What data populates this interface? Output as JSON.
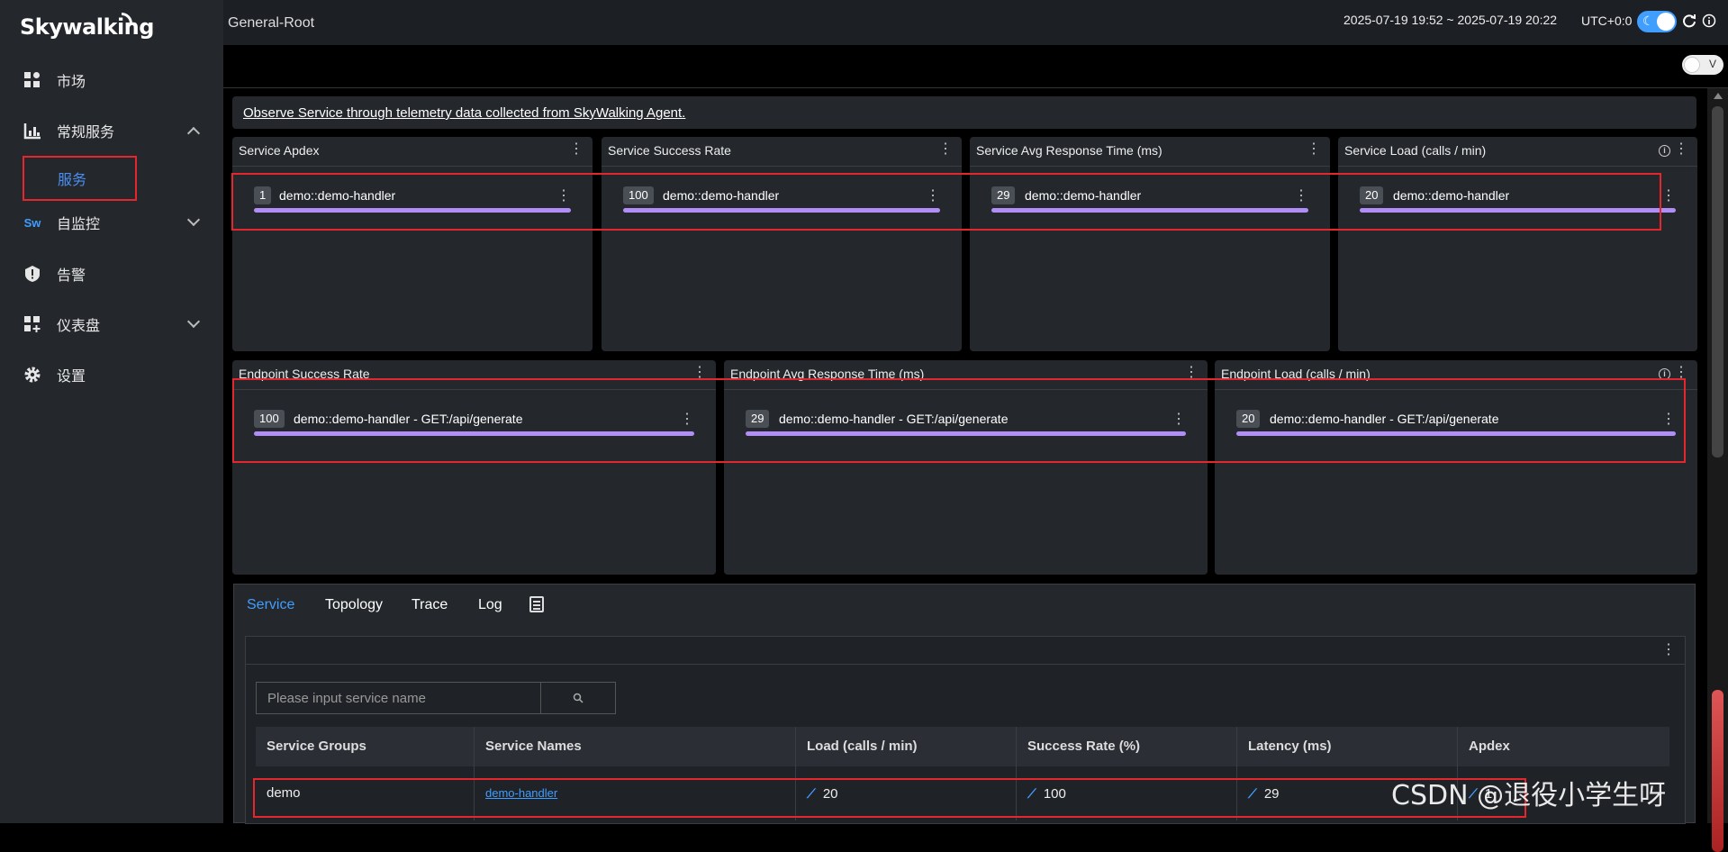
{
  "app": {
    "logo": "Skywalking"
  },
  "sidebar": {
    "items": [
      {
        "label": "市场",
        "icon": "market-icon"
      },
      {
        "label": "常规服务",
        "icon": "chart-icon",
        "expanded": true
      },
      {
        "label": "服务",
        "icon": ""
      },
      {
        "label": "自监控",
        "icon": "sw-icon",
        "icon_text": "Sw"
      },
      {
        "label": "告警",
        "icon": "alert-icon"
      },
      {
        "label": "仪表盘",
        "icon": "dashboard-icon"
      },
      {
        "label": "设置",
        "icon": "gear-icon"
      }
    ]
  },
  "topbar": {
    "breadcrumb": "General-Root",
    "time_range": "2025-07-19 19:52 ~ 2025-07-19 20:22",
    "timezone": "UTC+0:0",
    "theme_toggle_on": true,
    "version_toggle_label": "V"
  },
  "intro": {
    "text": "Observe Service through telemetry data collected from SkyWalking Agent."
  },
  "service_panels": [
    {
      "title": "Service Apdex",
      "badge": "1",
      "name": "demo::demo-handler",
      "info": false
    },
    {
      "title": "Service Success Rate",
      "badge": "100",
      "name": "demo::demo-handler",
      "info": false
    },
    {
      "title": "Service Avg Response Time (ms)",
      "badge": "29",
      "name": "demo::demo-handler",
      "info": false
    },
    {
      "title": "Service Load (calls / min)",
      "badge": "20",
      "name": "demo::demo-handler",
      "info": true
    }
  ],
  "endpoint_panels": [
    {
      "title": "Endpoint Success Rate",
      "badge": "100",
      "name": "demo::demo-handler - GET:/api/generate",
      "info": false
    },
    {
      "title": "Endpoint Avg Response Time (ms)",
      "badge": "29",
      "name": "demo::demo-handler - GET:/api/generate",
      "info": false
    },
    {
      "title": "Endpoint Load (calls / min)",
      "badge": "20",
      "name": "demo::demo-handler - GET:/api/generate",
      "info": true
    }
  ],
  "tabs": [
    {
      "label": "Service",
      "active": true
    },
    {
      "label": "Topology",
      "active": false
    },
    {
      "label": "Trace",
      "active": false
    },
    {
      "label": "Log",
      "active": false
    }
  ],
  "service_list": {
    "search_placeholder": "Please input service name",
    "columns": [
      "Service Groups",
      "Service Names",
      "Load (calls / min)",
      "Success Rate (%)",
      "Latency (ms)",
      "Apdex"
    ],
    "rows": [
      {
        "group": "demo",
        "name": "demo-handler",
        "load": "20",
        "success_rate": "100",
        "latency": "29",
        "apdex": "1"
      }
    ]
  },
  "watermark": "CSDN @退役小学生呀",
  "colors": {
    "accent": "#409eff",
    "highlight": "#e5262d",
    "bar": "#b18ef5"
  }
}
